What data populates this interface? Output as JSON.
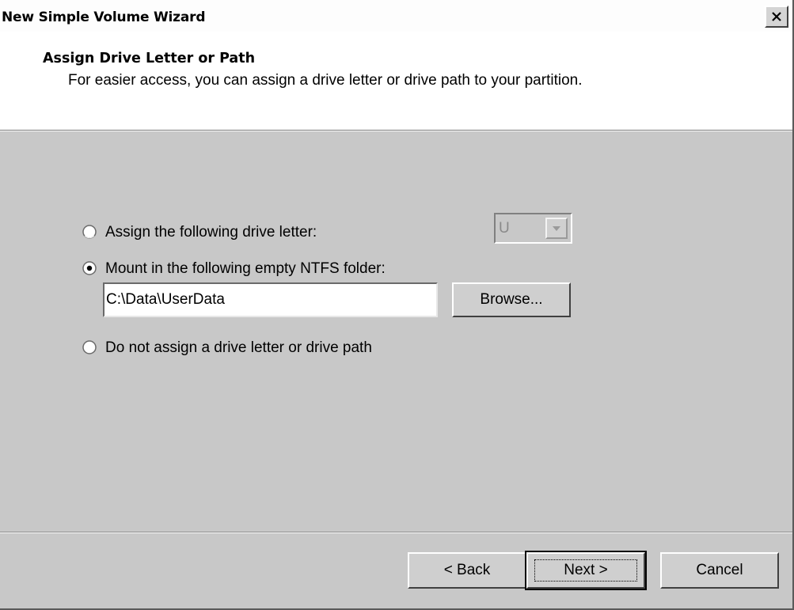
{
  "window": {
    "title": "New Simple Volume Wizard",
    "close_glyph": "×"
  },
  "header": {
    "title": "Assign Drive Letter or Path",
    "subtitle": "For easier access, you can assign a drive letter or drive path to your partition."
  },
  "options": {
    "assign_letter": {
      "label": "Assign the following drive letter:",
      "selected": false
    },
    "mount_folder": {
      "label": "Mount in the following empty NTFS folder:",
      "selected": true
    },
    "no_assign": {
      "label": "Do not assign a drive letter or drive path",
      "selected": false
    }
  },
  "drive_letter": {
    "value": "U",
    "enabled": false,
    "icon": "chevron-down-icon"
  },
  "folder_path": {
    "value": "C:\\Data\\UserData"
  },
  "buttons": {
    "browse": "Browse...",
    "back": "< Back",
    "next": "Next >",
    "cancel": "Cancel"
  },
  "colors": {
    "dialog_bg": "#c8c8c8",
    "header_bg": "#ffffff"
  }
}
